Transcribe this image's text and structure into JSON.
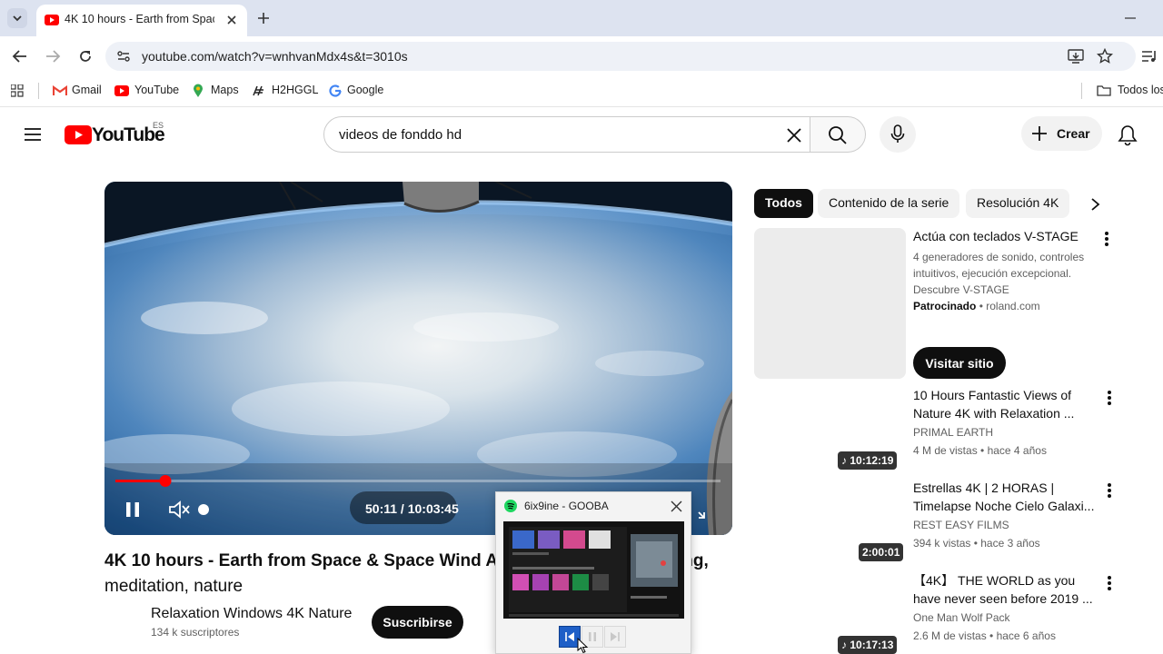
{
  "browser": {
    "tab_title": "4K 10 hours - Earth from Space",
    "url": "youtube.com/watch?v=wnhvanMdx4s&t=3010s",
    "bookmarks": [
      "Gmail",
      "YouTube",
      "Maps",
      "H2HGGL",
      "Google"
    ],
    "all_bookmarks": "Todos los"
  },
  "youtube": {
    "logo_text": "YouTube",
    "region": "ES",
    "search_query": "videos de fonddo hd",
    "create_label": "Crear"
  },
  "player": {
    "time": "50:11 / 10:03:45",
    "progress_fraction": 0.083,
    "muted": true
  },
  "video": {
    "title": "4K 10 hours - Earth from Space & Space Wind Au",
    "title_tail": "ing,",
    "title_line2": "meditation, nature",
    "channel": "Relaxation Windows 4K Nature",
    "subscribers": "134 k suscriptores",
    "subscribe_label": "Suscribirse"
  },
  "chips": [
    "Todos",
    "Contenido de la serie",
    "Resolución 4K"
  ],
  "ad": {
    "title": "Actúa con teclados V-STAGE",
    "desc_lines": [
      "4 generadores de sonido, controles",
      "intuitivos, ejecución excepcional.",
      "Descubre V-STAGE"
    ],
    "sponsored": "Patrocinado",
    "domain": "roland.com",
    "cta": "Visitar sitio"
  },
  "related": [
    {
      "title_l1": "10 Hours Fantastic Views of",
      "title_l2": "Nature 4K with Relaxation ...",
      "channel": "PRIMAL EARTH",
      "meta": "4 M de vistas • hace 4 años",
      "duration": "10:12:19"
    },
    {
      "title_l1": "Estrellas 4K | 2 HORAS |",
      "title_l2": "Timelapse Noche Cielo Galaxi...",
      "channel": "REST EASY FILMS",
      "meta": "394 k vistas • hace 3 años",
      "duration": "2:00:01"
    },
    {
      "title_l1": "【4K】 THE WORLD as you",
      "title_l2": "have never seen before 2019 ...",
      "channel": "One Man Wolf Pack",
      "meta": "2.6 M de vistas • hace 6 años",
      "duration": "10:17:13"
    }
  ],
  "mini_player": {
    "title": "6ix9ine - GOOBA",
    "accent": "#1ed760"
  }
}
